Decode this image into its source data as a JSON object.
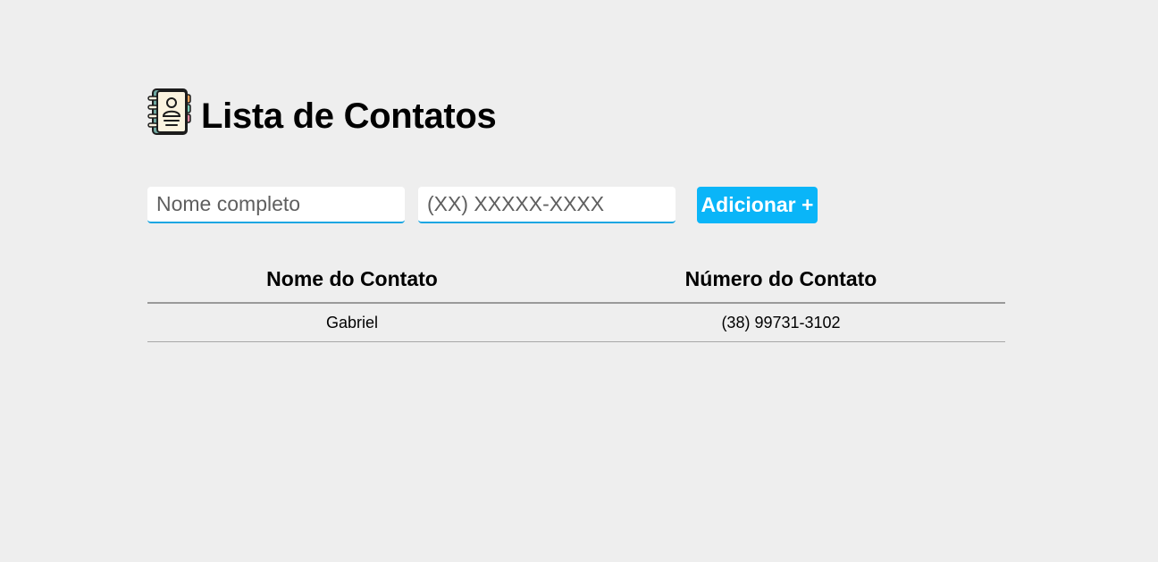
{
  "header": {
    "title": "Lista de Contatos",
    "icon": "address-book-icon"
  },
  "form": {
    "name_placeholder": "Nome completo",
    "name_value": "",
    "phone_placeholder": "(XX) XXXXX-XXXX",
    "phone_value": "",
    "add_button_label": "Adicionar +"
  },
  "table": {
    "headers": [
      "Nome do Contato",
      "Número do Contato"
    ],
    "rows": [
      {
        "name": "Gabriel",
        "number": "(38) 99731-3102"
      }
    ]
  },
  "colors": {
    "background": "#eeeeee",
    "accent": "#0ab5f8",
    "input_underline": "#1ba6e2"
  }
}
